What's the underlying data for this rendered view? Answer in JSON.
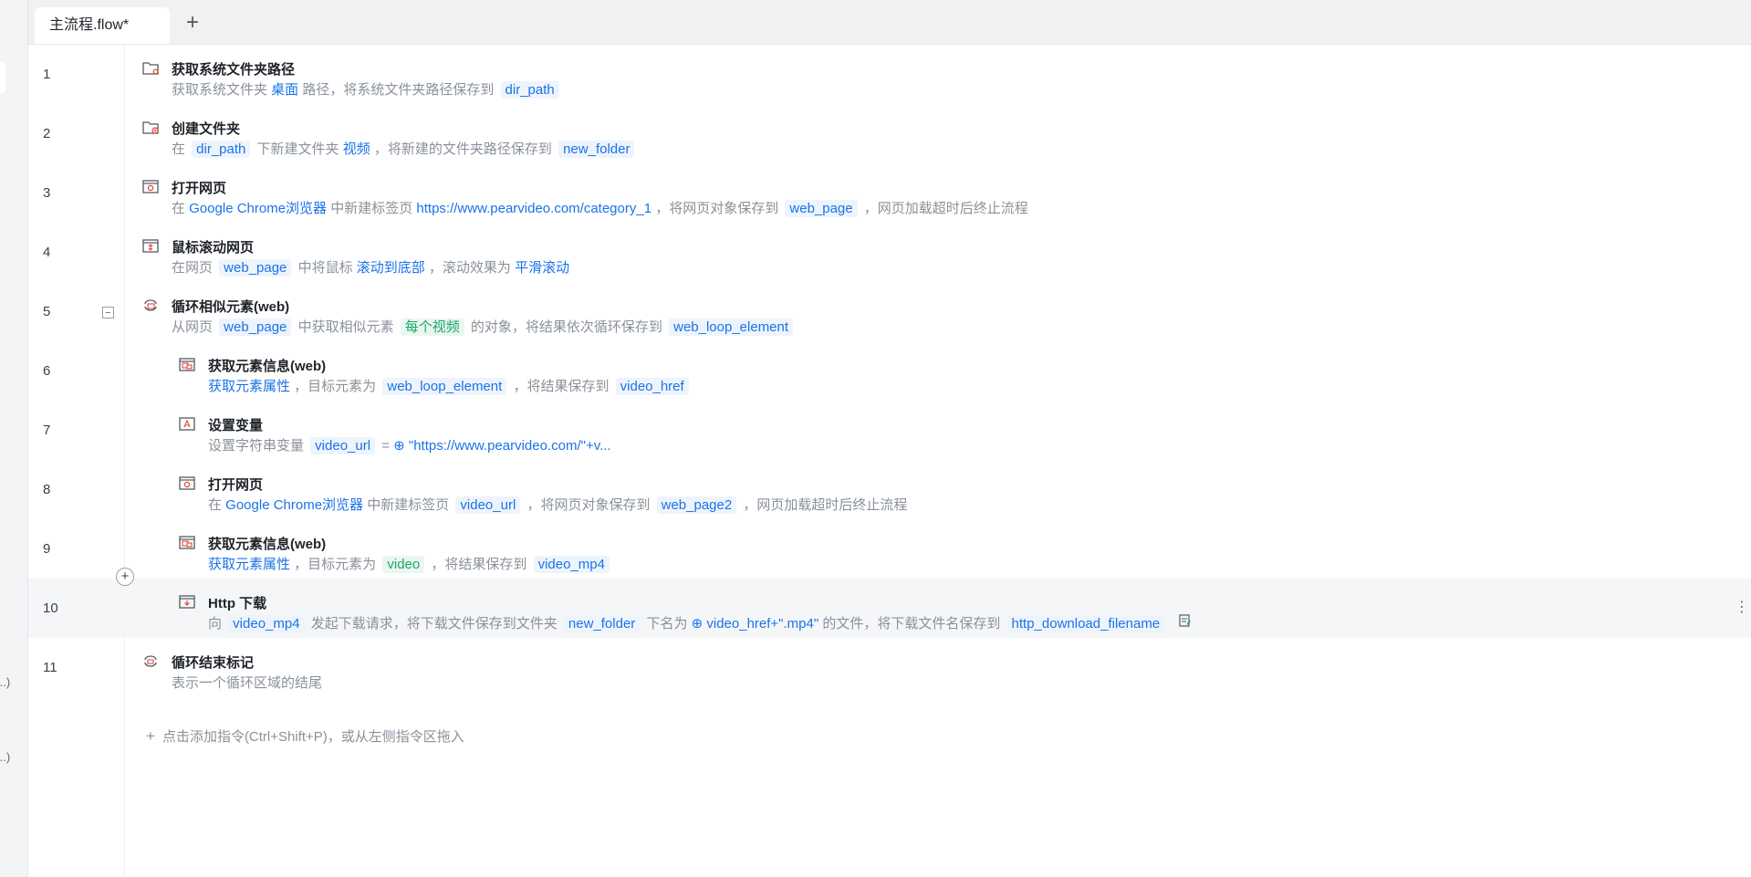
{
  "tabs": {
    "active": "主流程.flow*",
    "add_symbol": "+"
  },
  "sidebar": {
    "truncated_1": "...)",
    "truncated_2": "...)"
  },
  "steps": [
    {
      "line": "1",
      "title": "获取系统文件夹路径",
      "icon": "folder-icon",
      "desc": [
        [
          "t",
          "获取系统文件夹 "
        ],
        [
          "k",
          "桌面"
        ],
        [
          "t",
          " 路径，将系统文件夹路径保存到 "
        ],
        [
          "v",
          "dir_path"
        ]
      ]
    },
    {
      "line": "2",
      "title": "创建文件夹",
      "icon": "folder-add-icon",
      "desc": [
        [
          "t",
          "在 "
        ],
        [
          "v",
          "dir_path"
        ],
        [
          "t",
          " 下新建文件夹 "
        ],
        [
          "k",
          "视频"
        ],
        [
          "t",
          " ，将新建的文件夹路径保存到 "
        ],
        [
          "v",
          "new_folder"
        ]
      ]
    },
    {
      "line": "3",
      "title": "打开网页",
      "icon": "browser-icon",
      "desc": [
        [
          "t",
          "在 "
        ],
        [
          "k",
          "Google Chrome浏览器"
        ],
        [
          "t",
          " 中新建标签页 "
        ],
        [
          "k",
          "https://www.pearvideo.com/category_1"
        ],
        [
          "t",
          " ，将网页对象保存到 "
        ],
        [
          "v",
          "web_page"
        ],
        [
          "t",
          " ，网页加载超时后终止流程"
        ]
      ]
    },
    {
      "line": "4",
      "title": "鼠标滚动网页",
      "icon": "scroll-icon",
      "desc": [
        [
          "t",
          "在网页 "
        ],
        [
          "v",
          "web_page"
        ],
        [
          "t",
          " 中将鼠标 "
        ],
        [
          "k",
          "滚动到底部"
        ],
        [
          "t",
          " ，滚动效果为 "
        ],
        [
          "k",
          "平滑滚动"
        ]
      ]
    },
    {
      "line": "5",
      "title": "循环相似元素(web)",
      "icon": "loop-icon",
      "desc": [
        [
          "t",
          "从网页 "
        ],
        [
          "v",
          "web_page"
        ],
        [
          "t",
          " 中获取相似元素 "
        ],
        [
          "g",
          "每个视频"
        ],
        [
          "t",
          " 的对象，将结果依次循环保存到 "
        ],
        [
          "v",
          "web_loop_element"
        ]
      ]
    },
    {
      "line": "6",
      "title": "获取元素信息(web)",
      "icon": "element-info-icon",
      "desc": [
        [
          "k",
          "获取元素属性"
        ],
        [
          "t",
          " ，目标元素为 "
        ],
        [
          "v",
          "web_loop_element"
        ],
        [
          "t",
          " ，将结果保存到 "
        ],
        [
          "v",
          "video_href"
        ]
      ]
    },
    {
      "line": "7",
      "title": "设置变量",
      "icon": "variable-icon",
      "desc": [
        [
          "t",
          "设置字符串变量 "
        ],
        [
          "v",
          "video_url"
        ],
        [
          "t",
          " = "
        ],
        [
          "ex",
          "⊕ \"https://www.pearvideo.com/\"+v..."
        ]
      ]
    },
    {
      "line": "8",
      "title": "打开网页",
      "icon": "browser-icon",
      "desc": [
        [
          "t",
          "在 "
        ],
        [
          "k",
          "Google Chrome浏览器"
        ],
        [
          "t",
          " 中新建标签页 "
        ],
        [
          "v",
          "video_url"
        ],
        [
          "t",
          " ，将网页对象保存到 "
        ],
        [
          "v",
          "web_page2"
        ],
        [
          "t",
          " ，网页加载超时后终止流程"
        ]
      ]
    },
    {
      "line": "9",
      "title": "获取元素信息(web)",
      "icon": "element-info-icon",
      "desc": [
        [
          "k",
          "获取元素属性"
        ],
        [
          "t",
          " ，目标元素为 "
        ],
        [
          "g",
          "video"
        ],
        [
          "t",
          " ，将结果保存到 "
        ],
        [
          "v",
          "video_mp4"
        ]
      ]
    },
    {
      "line": "10",
      "title": "Http 下载",
      "icon": "download-icon",
      "desc": [
        [
          "t",
          "向 "
        ],
        [
          "v",
          "video_mp4"
        ],
        [
          "t",
          " 发起下载请求，将下载文件保存到文件夹 "
        ],
        [
          "v",
          "new_folder"
        ],
        [
          "t",
          " 下名为 "
        ],
        [
          "ex",
          "⊕ video_href+\".mp4\""
        ],
        [
          "t",
          " 的文件，将下载文件名保存到 "
        ],
        [
          "v",
          "http_download_filename"
        ]
      ]
    },
    {
      "line": "11",
      "title": "循环结束标记",
      "icon": "loop-end-icon",
      "desc": [
        [
          "t",
          "表示一个循环区域的结尾"
        ]
      ]
    }
  ],
  "add_hint": "点击添加指令(Ctrl+Shift+P)，或从左侧指令区拖入",
  "collapse_symbol": "−",
  "insert_symbol": "+",
  "more_symbol": "⋮"
}
